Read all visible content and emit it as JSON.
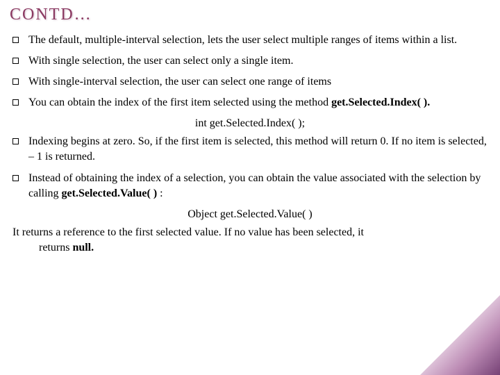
{
  "title": "CONTD…",
  "bullets": {
    "b1": "The default, multiple-interval selection, lets the user select multiple ranges of items within a list.",
    "b2": "With single selection, the user can select only a single item.",
    "b3": "With single-interval selection, the user can select one range of items",
    "b4_a": "You can obtain the index of the first item selected using the method ",
    "b4_b": "get.Selected.Index( ).",
    "code1": "int get.Selected.Index( );",
    "b5": "Indexing begins at zero. So, if the first item is selected, this method will return 0. If no item is selected, – 1 is returned.",
    "b6_a": "Instead of obtaining the index of a selection, you can obtain the value associated with the selection by calling ",
    "b6_b": "get.Selected.Value( )",
    "b6_c": " :",
    "code2": "Object get.Selected.Value( )"
  },
  "footer": {
    "line1": "It returns a reference to the first selected value. If no value has been selected, it",
    "line2_a": "returns ",
    "line2_b": "null."
  }
}
